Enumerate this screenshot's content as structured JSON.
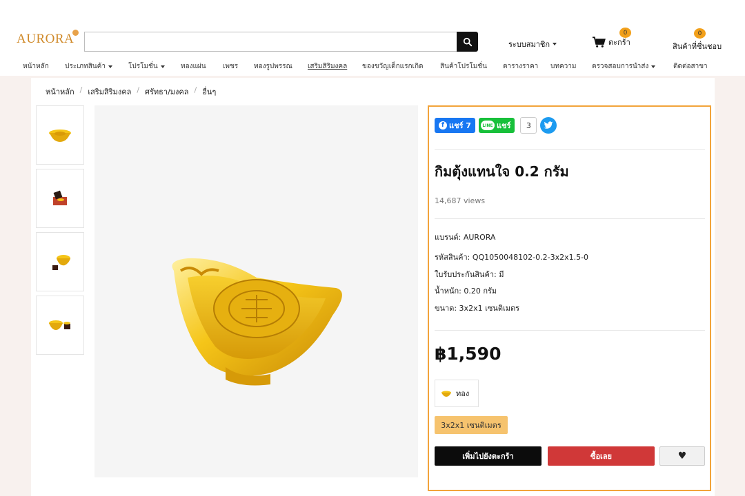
{
  "brand_logo": "AURORA",
  "header": {
    "search_placeholder": "",
    "member_label": "ระบบสมาชิก",
    "cart_label": "ตะกร้า",
    "cart_count": "0",
    "wishlist_label": "สินค้าที่ชื่นชอบ",
    "wishlist_count": "0"
  },
  "nav": {
    "items": [
      {
        "label": "หน้าหลัก"
      },
      {
        "label": "ประเภทสินค้า"
      },
      {
        "label": "โปรโมชั่น"
      },
      {
        "label": "ทองแผ่น"
      },
      {
        "label": "เพชร"
      },
      {
        "label": "ทองรูปพรรณ"
      },
      {
        "label": "เสริมสิริมงคล"
      },
      {
        "label": "ของขวัญเด็กแรกเกิด"
      },
      {
        "label": "สินค้าโปรโมชั่น"
      },
      {
        "label": "ตารางราคา"
      },
      {
        "label": "บทความ"
      },
      {
        "label": "ตรวจสอบการนำส่ง"
      },
      {
        "label": "ติดต่อสาขา"
      }
    ]
  },
  "breadcrumb": [
    "หน้าหลัก",
    "เสริมสิริมงคล",
    "ศรัทธา/มงคล",
    "อื่นๆ"
  ],
  "product": {
    "share": {
      "facebook": "แชร์ 7",
      "line": "แชร์",
      "count": "3"
    },
    "title": "กิมตุ้งแทนใจ 0.2 กรัม",
    "views": "14,687 views",
    "specs": [
      "แบรนด์: AURORA",
      "รหัสสินค้า: QQ1050048102-0.2-3x2x1.5-0",
      "ใบรับประกันสินค้า: มี",
      "น้ำหนัก: 0.20 กรัม",
      "ขนาด: 3x2x1 เซนติเมตร"
    ],
    "price": "฿1,590",
    "variant_label": "ทอง",
    "size_label": "3x2x1 เซนติเมตร",
    "add_to_cart": "เพิ่มไปยังตะกร้า",
    "buy_now": "ซื้อเลย",
    "wish_icon": "♥"
  },
  "colors": {
    "accent": "#f2a33a",
    "buy": "#d03838",
    "gold": "#f5c518"
  }
}
